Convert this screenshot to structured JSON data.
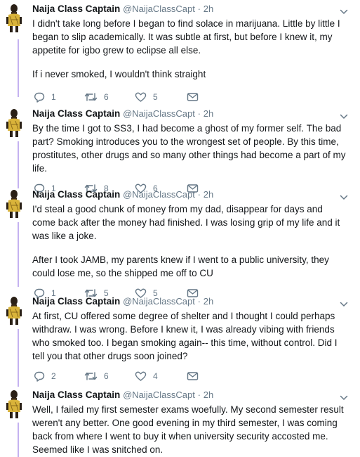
{
  "tweets": [
    {
      "name": "Naija Class Captain",
      "handle": "@NaijaClassCapt",
      "separator": "·",
      "time": "2h",
      "paragraphs": [
        "I didn't take long before I began to find solace in marijuana. Little by little I began to slip academically. It was subtle at first, but before I knew it, my appetite for igbo grew to eclipse all else.",
        "If i never smoked, I wouldn't think straight"
      ],
      "replies": "1",
      "retweets": "6",
      "likes": "5"
    },
    {
      "name": "Naija Class Captain",
      "handle": "@NaijaClassCapt",
      "separator": "·",
      "time": "2h",
      "paragraphs": [
        "By the time I got to SS3, I had become a ghost of my former self. The bad part? Smoking introduces you to the wrongest set of people.  By this time, prostitutes, other drugs and so many other things had become a part of my life."
      ],
      "replies": "1",
      "retweets": "8",
      "likes": "6"
    },
    {
      "name": "Naija Class Captain",
      "handle": "@NaijaClassCapt",
      "separator": "·",
      "time": "2h",
      "paragraphs": [
        "I'd steal a good chunk of money from my dad, disappear for days and come back after the money had finished. I was losing grip of my life and it was like a joke.",
        "After I took JAMB, my parents knew if I went to a public university, they could lose me, so the shipped me off to CU"
      ],
      "replies": "1",
      "retweets": "5",
      "likes": "5"
    },
    {
      "name": "Naija Class Captain",
      "handle": "@NaijaClassCapt",
      "separator": "·",
      "time": "2h",
      "paragraphs": [
        "At first, CU offered some degree of shelter and I thought I could perhaps withdraw. I was wrong. Before I knew it, I was already vibing with friends who smoked too. I began smoking again-- this time, without control. Did I tell you that other drugs soon joined?"
      ],
      "replies": "2",
      "retweets": "6",
      "likes": "4"
    },
    {
      "name": "Naija Class Captain",
      "handle": "@NaijaClassCapt",
      "separator": "·",
      "time": "2h",
      "paragraphs": [
        "Well, I failed my first semester exams woefully. My second semester result weren't any better. One good evening in my third semester, I was coming back from where I went to buy it when university security accosted me. Seemed like I was snitched on."
      ],
      "replies": "",
      "retweets": "",
      "likes": ""
    }
  ],
  "colors": {
    "thread_line": "#c4b2f0",
    "icon": "#657786",
    "name": "#14171a",
    "meta": "#657786"
  }
}
